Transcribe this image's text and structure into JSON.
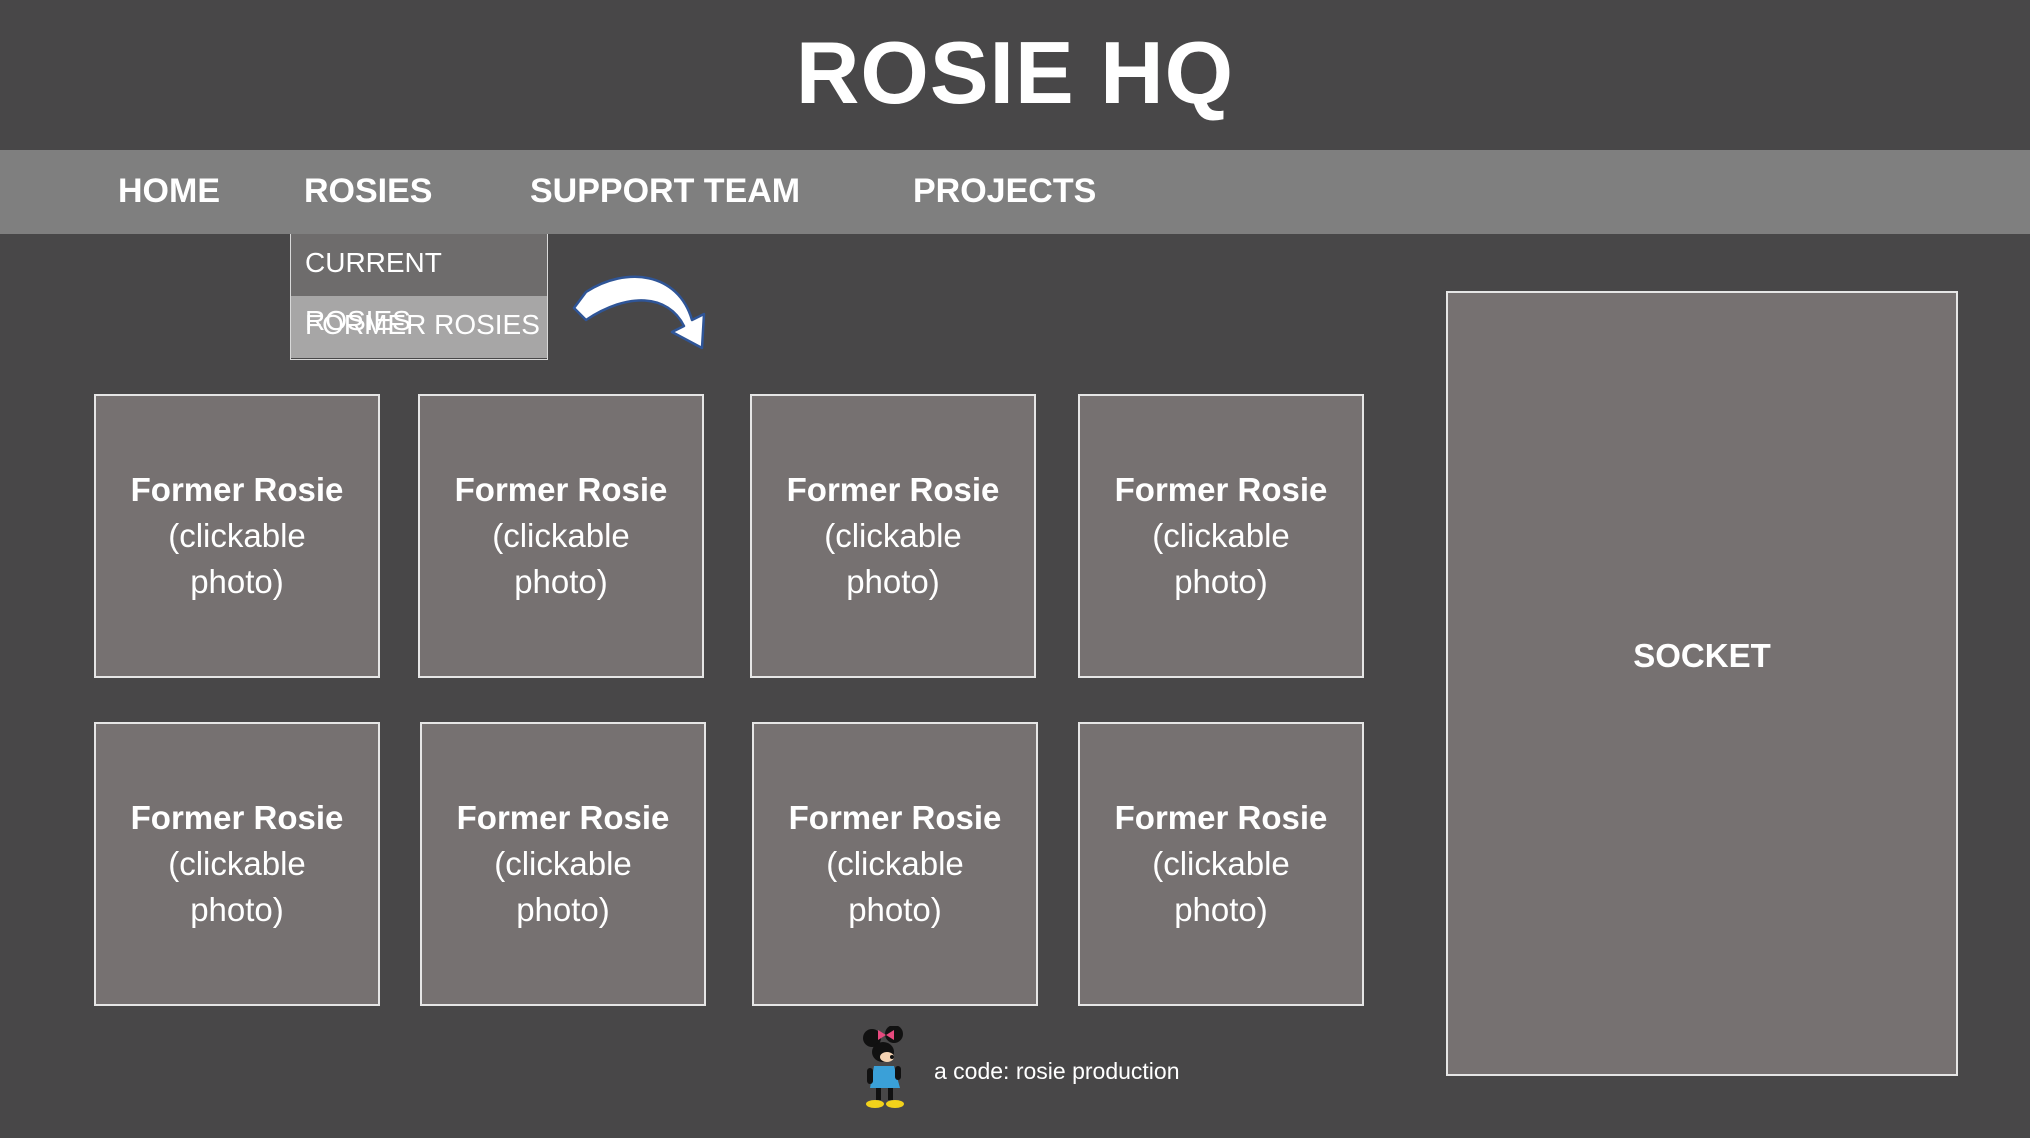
{
  "header": {
    "title": "ROSIE HQ"
  },
  "nav": {
    "items": [
      {
        "label": "HOME"
      },
      {
        "label": "ROSIES"
      },
      {
        "label": "SUPPORT TEAM"
      },
      {
        "label": "PROJECTS"
      }
    ]
  },
  "dropdown": {
    "items": [
      {
        "label": "CURRENT ROSIES"
      },
      {
        "label": "FORMER ROSIES"
      }
    ]
  },
  "gallery": {
    "tiles": [
      {
        "name": "Former Rosie",
        "caption": "(clickable photo)"
      },
      {
        "name": "Former Rosie",
        "caption": "(clickable photo)"
      },
      {
        "name": "Former Rosie",
        "caption": "(clickable photo)"
      },
      {
        "name": "Former Rosie",
        "caption": "(clickable photo)"
      },
      {
        "name": "Former Rosie",
        "caption": "(clickable photo)"
      },
      {
        "name": "Former Rosie",
        "caption": "(clickable photo)"
      },
      {
        "name": "Former Rosie",
        "caption": "(clickable photo)"
      },
      {
        "name": "Former Rosie",
        "caption": "(clickable photo)"
      }
    ]
  },
  "socket": {
    "label": "SOCKET"
  },
  "footer": {
    "credit": "a code: rosie production",
    "icon": "mouse-character-icon"
  },
  "colors": {
    "background": "#484748",
    "navbar": "#7f7f7f",
    "tile": "#767171",
    "dropdown_active": "#a7a6a6"
  }
}
